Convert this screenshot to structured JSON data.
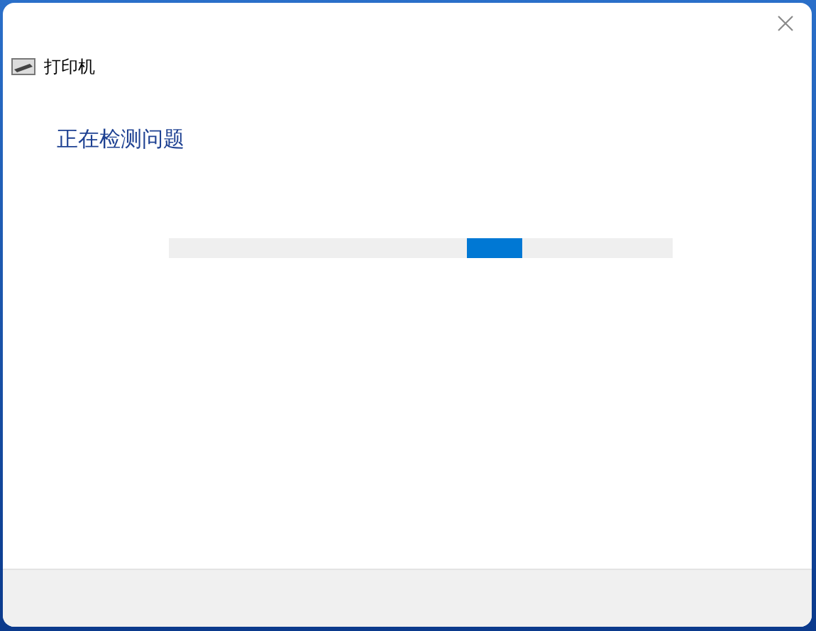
{
  "window": {
    "title": "打印机"
  },
  "heading": "正在检测问题",
  "progress_bar": {
    "indeterminate": true
  }
}
